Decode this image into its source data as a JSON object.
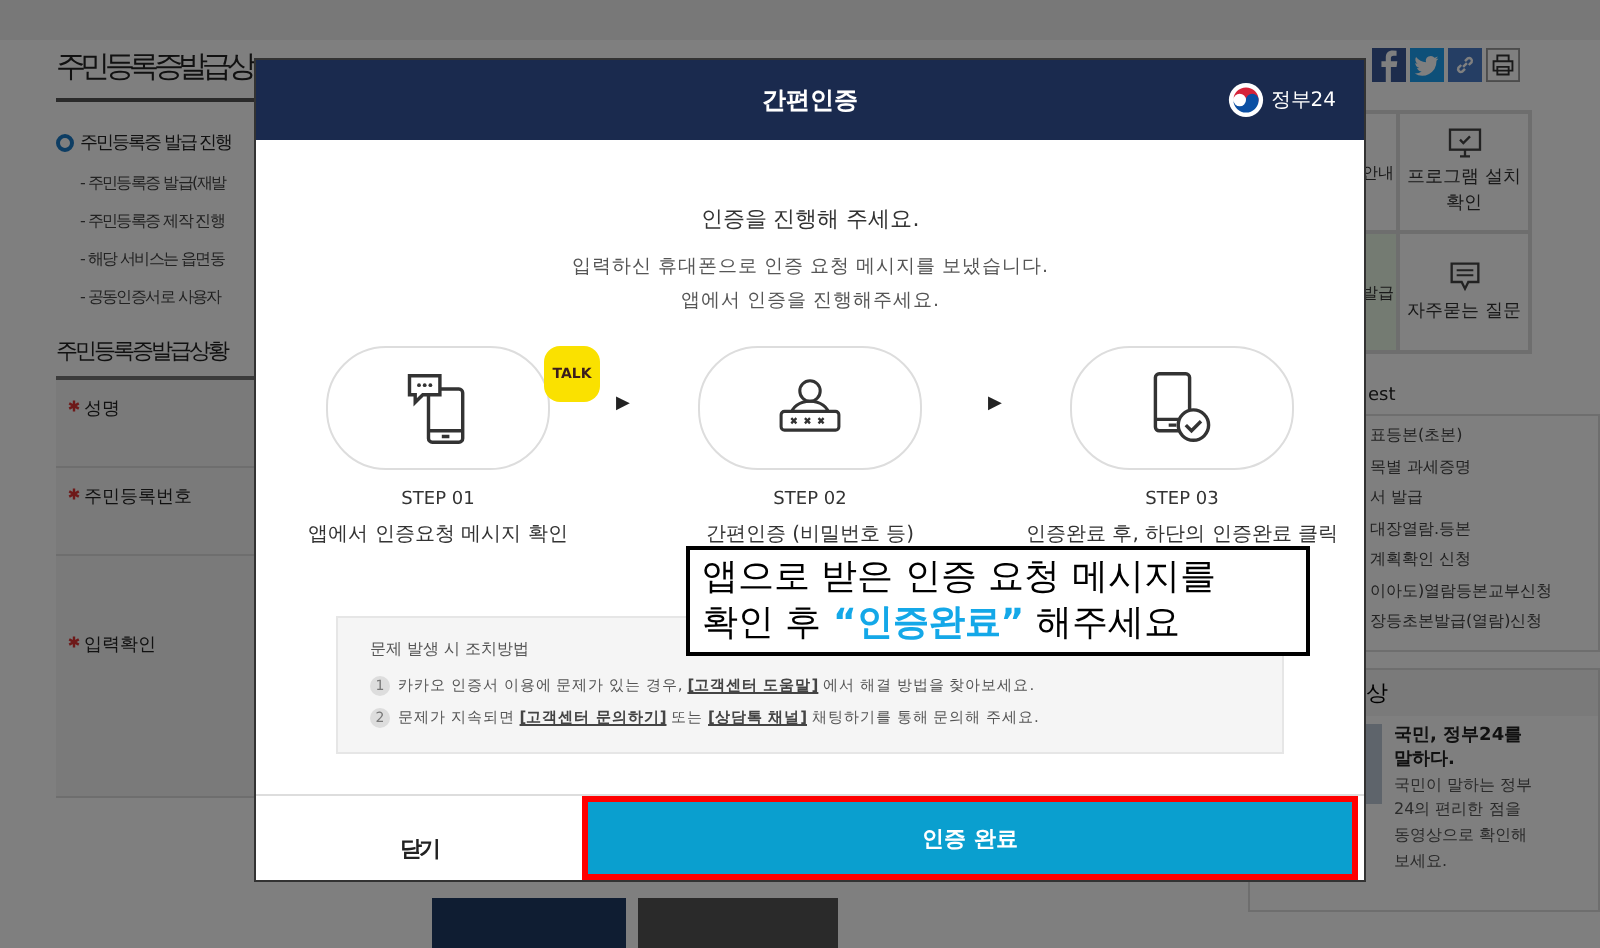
{
  "page": {
    "title": "주민등록증발급상",
    "notice": {
      "heading": "주민등록증 발급 진행",
      "items": [
        "- 주민등록증 발급(재발",
        "- 주민등록증 제작 진행",
        "- 해당 서비스는 읍면동",
        "- 공동인증서로 사용자"
      ]
    },
    "form": {
      "heading": "주민등록증발급상황",
      "fields": [
        {
          "label": "성명",
          "required": true
        },
        {
          "label": "주민등록번호",
          "required": true
        },
        {
          "label": "입력확인",
          "required": true
        }
      ]
    }
  },
  "sidebar": {
    "shortcuts": [
      {
        "label": "안내",
        "selected": false
      },
      {
        "label": "프로그램 설치\n확인",
        "selected": false
      },
      {
        "label": "발급",
        "selected": true
      },
      {
        "label": "자주묻는 질문",
        "selected": false
      }
    ],
    "list_heading": "est",
    "list": [
      "표등본(초본)",
      "목별 과세증명",
      "서 발급",
      "대장열람.등본",
      "계획확인 신청",
      "이아도)열람등본교부신청",
      "장등초본발급(열람)신청"
    ],
    "video": {
      "heading": "상",
      "title": "국민, 정부24를 말하다.",
      "text": "국민이 말하는 정부24의 편리한 점을 동영상으로 확인해 보세요."
    }
  },
  "modal": {
    "title": "간편인증",
    "logo": "정부24",
    "intro": "인증을 진행해 주세요.",
    "message": [
      "입력하신 휴대폰으로 인증 요청 메시지를 보냈습니다.",
      "앱에서 인증을 진행해주세요."
    ],
    "steps": [
      {
        "kind": "message",
        "step": "STEP 01",
        "text": "앱에서 인증요청 메시지 확인",
        "badge": "TALK"
      },
      {
        "kind": "password",
        "step": "STEP 02",
        "text": "간편인증 (비밀번호 등)"
      },
      {
        "kind": "complete",
        "step": "STEP 03",
        "text": "인증완료 후, 하단의 인증완료 클릭"
      }
    ],
    "arrows": [
      "▶",
      "▶"
    ],
    "help": {
      "title": "문제 발생 시 조치방법",
      "items": [
        {
          "number": "1",
          "parts": [
            {
              "kind": "text",
              "text": "카카오 인증서 이용에 문제가 있는 경우, "
            },
            {
              "kind": "link",
              "text": "[고객센터 도움말]"
            },
            {
              "kind": "text",
              "text": " 에서 해결 방법을 찾아보세요."
            }
          ]
        },
        {
          "number": "2",
          "parts": [
            {
              "kind": "text",
              "text": "문제가 지속되면 "
            },
            {
              "kind": "link",
              "text": "[고객센터 문의하기]"
            },
            {
              "kind": "text",
              "text": " 또는 "
            },
            {
              "kind": "link",
              "text": "[상담톡 채널]"
            },
            {
              "kind": "text",
              "text": " 채팅하기를 통해 문의해 주세요."
            }
          ]
        }
      ]
    },
    "callout": "앱으로 받은 인증 요청 메시지를\n확인 후 **“인증완료”** 해주세요",
    "buttons": [
      {
        "label": "닫기",
        "kind": "secondary",
        "highlighted": false
      },
      {
        "label": "인증 완료",
        "kind": "primary",
        "highlighted": true
      }
    ]
  }
}
